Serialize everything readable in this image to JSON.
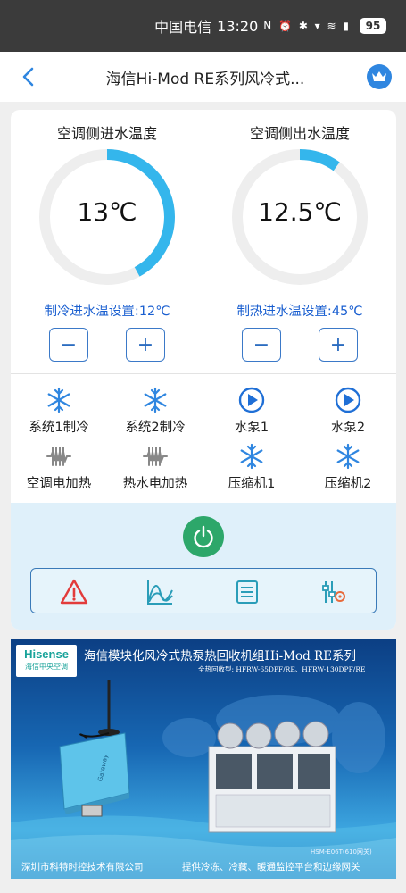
{
  "statusbar": {
    "carrier": "中国电信",
    "time": "13:20",
    "icons": "N ⏰ ✱ ▾ ≋ ▮",
    "battery": "95"
  },
  "nav": {
    "title": "海信Hi-Mod RE系列风冷式..."
  },
  "gauges": [
    {
      "title": "空调侧进水温度",
      "value": "13℃",
      "fraction": 0.42
    },
    {
      "title": "空调侧出水温度",
      "value": "12.5℃",
      "fraction": 0.1
    }
  ],
  "settings": {
    "cooling": "制冷进水温设置:12℃",
    "heating": "制热进水温设置:45℃"
  },
  "buttons": {
    "minus": "−",
    "plus": "+"
  },
  "status_items": [
    {
      "label": "系统1制冷",
      "icon": "snowflake-icon"
    },
    {
      "label": "系统2制冷",
      "icon": "snowflake-icon"
    },
    {
      "label": "水泵1",
      "icon": "pump-play-icon"
    },
    {
      "label": "水泵2",
      "icon": "pump-play-icon"
    },
    {
      "label": "空调电加热",
      "icon": "heater-icon"
    },
    {
      "label": "热水电加热",
      "icon": "heater-icon"
    },
    {
      "label": "压缩机1",
      "icon": "snowflake-icon"
    },
    {
      "label": "压缩机2",
      "icon": "snowflake-icon"
    }
  ],
  "toolbar": [
    "alarm-icon",
    "chart-icon",
    "list-icon",
    "settings-sliders-icon"
  ],
  "colors": {
    "accent": "#2f86e0",
    "gauge_track": "#eeeeee",
    "gauge_fill": "#34b6ec",
    "setting_text": "#1a5fd0",
    "power_green": "#2da76a",
    "alarm_red": "#e23b3b",
    "toolbar_teal": "#2a9db8"
  },
  "banner": {
    "brand": "Hisense",
    "brand_sub": "海信中央空调",
    "title": "海信模块化风冷式热泵热回收机组Hi-Mod RE系列",
    "subtitle": "全热回收型: HFRW-65DPF/RE、HFRW-130DPF/RE",
    "footer_left": "深圳市科特时控技术有限公司",
    "footer_right": "提供冷冻、冷藏、暖通监控平台和边缘网关",
    "model_tag": "HSM-E06T(610网关)",
    "device_label": "Gateway"
  }
}
